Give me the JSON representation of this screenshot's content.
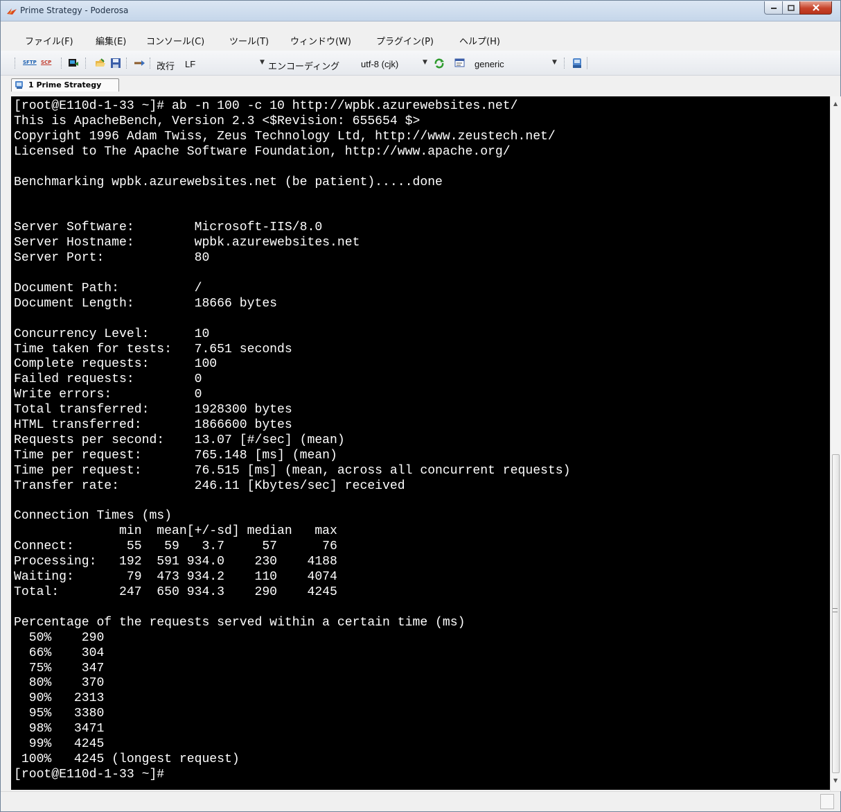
{
  "window": {
    "title": "Prime Strategy - Poderosa"
  },
  "menu": {
    "items": [
      "ファイル(F)",
      "編集(E)",
      "コンソール(C)",
      "ツール(T)",
      "ウィンドウ(W)",
      "プラグイン(P)",
      "ヘルプ(H)"
    ]
  },
  "toolbar": {
    "sftp_label": "SFTP",
    "scp_label": "SCP",
    "newline_label": "改行",
    "newline_value": "LF",
    "encoding_label": "エンコーディング",
    "encoding_value": "utf-8 (cjk)",
    "terminal_type_value": "generic"
  },
  "tab": {
    "label": "1 Prime Strategy"
  },
  "terminal": {
    "lines": [
      "[root@E110d-1-33 ~]# ab -n 100 -c 10 http://wpbk.azurewebsites.net/",
      "This is ApacheBench, Version 2.3 <$Revision: 655654 $>",
      "Copyright 1996 Adam Twiss, Zeus Technology Ltd, http://www.zeustech.net/",
      "Licensed to The Apache Software Foundation, http://www.apache.org/",
      "",
      "Benchmarking wpbk.azurewebsites.net (be patient).....done",
      "",
      "",
      "Server Software:        Microsoft-IIS/8.0",
      "Server Hostname:        wpbk.azurewebsites.net",
      "Server Port:            80",
      "",
      "Document Path:          /",
      "Document Length:        18666 bytes",
      "",
      "Concurrency Level:      10",
      "Time taken for tests:   7.651 seconds",
      "Complete requests:      100",
      "Failed requests:        0",
      "Write errors:           0",
      "Total transferred:      1928300 bytes",
      "HTML transferred:       1866600 bytes",
      "Requests per second:    13.07 [#/sec] (mean)",
      "Time per request:       765.148 [ms] (mean)",
      "Time per request:       76.515 [ms] (mean, across all concurrent requests)",
      "Transfer rate:          246.11 [Kbytes/sec] received",
      "",
      "Connection Times (ms)",
      "              min  mean[+/-sd] median   max",
      "Connect:       55   59   3.7     57      76",
      "Processing:   192  591 934.0    230    4188",
      "Waiting:       79  473 934.2    110    4074",
      "Total:        247  650 934.3    290    4245",
      "",
      "Percentage of the requests served within a certain time (ms)",
      "  50%    290",
      "  66%    304",
      "  75%    347",
      "  80%    370",
      "  90%   2313",
      "  95%   3380",
      "  98%   3471",
      "  99%   4245",
      " 100%   4245 (longest request)",
      "[root@E110d-1-33 ~]#"
    ]
  }
}
